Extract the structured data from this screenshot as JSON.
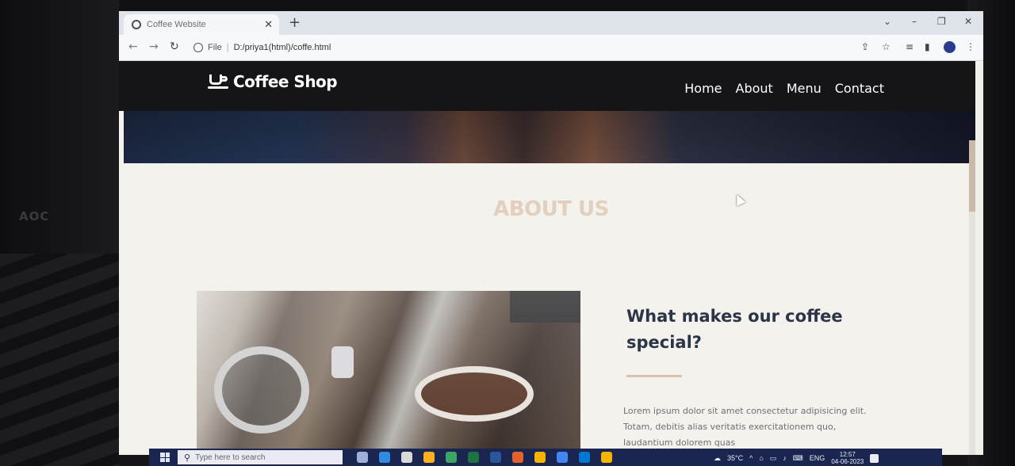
{
  "browser": {
    "tab_title": "Coffee Website",
    "new_tab": "+",
    "url_prefix": "File",
    "url": "D:/priya1(html)/coffe.html"
  },
  "site": {
    "logo_text": "Coffee Shop",
    "nav": [
      {
        "label": "Home"
      },
      {
        "label": "About"
      },
      {
        "label": "Menu"
      },
      {
        "label": "Contact"
      }
    ]
  },
  "about": {
    "title": "ABOUT US",
    "heading": "What makes our coffee special?",
    "text": "Lorem ipsum dolor sit amet consectetur adipisicing elit. Totam, debitis alias veritatis exercitationem quo, laudantium dolorem quas"
  },
  "taskbar": {
    "search_placeholder": "Type here to search",
    "temperature": "35°C",
    "language": "ENG",
    "time": "12:57",
    "date": "04-06-2023"
  },
  "bezel": {
    "brand": "AOC"
  }
}
